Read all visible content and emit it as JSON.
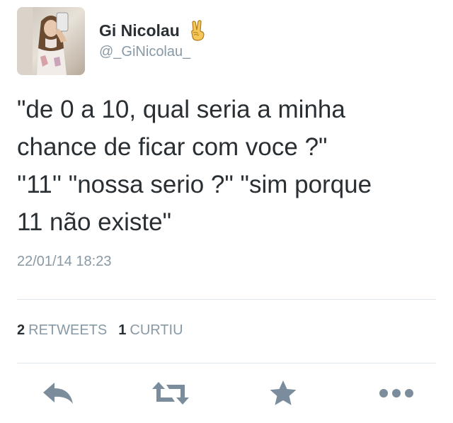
{
  "user": {
    "display_name": "Gi Nicolau",
    "handle": "@_GiNicolau_",
    "name_emoji_icon": "victory-hand-icon"
  },
  "tweet": {
    "text": "\"de 0 a 10, qual seria a minha\nchance de ficar com voce ?\"\n''11'' \"nossa serio ?\" \"sim porque\n11 não existe\"",
    "timestamp": "22/01/14 18:23"
  },
  "stats": {
    "retweets_count": "2",
    "retweets_label": "RETWEETS",
    "likes_count": "1",
    "likes_label": "CURTIU"
  },
  "actions": [
    {
      "icon": "reply-icon"
    },
    {
      "icon": "retweet-icon"
    },
    {
      "icon": "star-icon"
    },
    {
      "icon": "more-icon"
    }
  ],
  "colors": {
    "text": "#292f33",
    "secondary": "#8899a6",
    "icon": "#7b8d9c",
    "divider": "#e1e8ed"
  }
}
